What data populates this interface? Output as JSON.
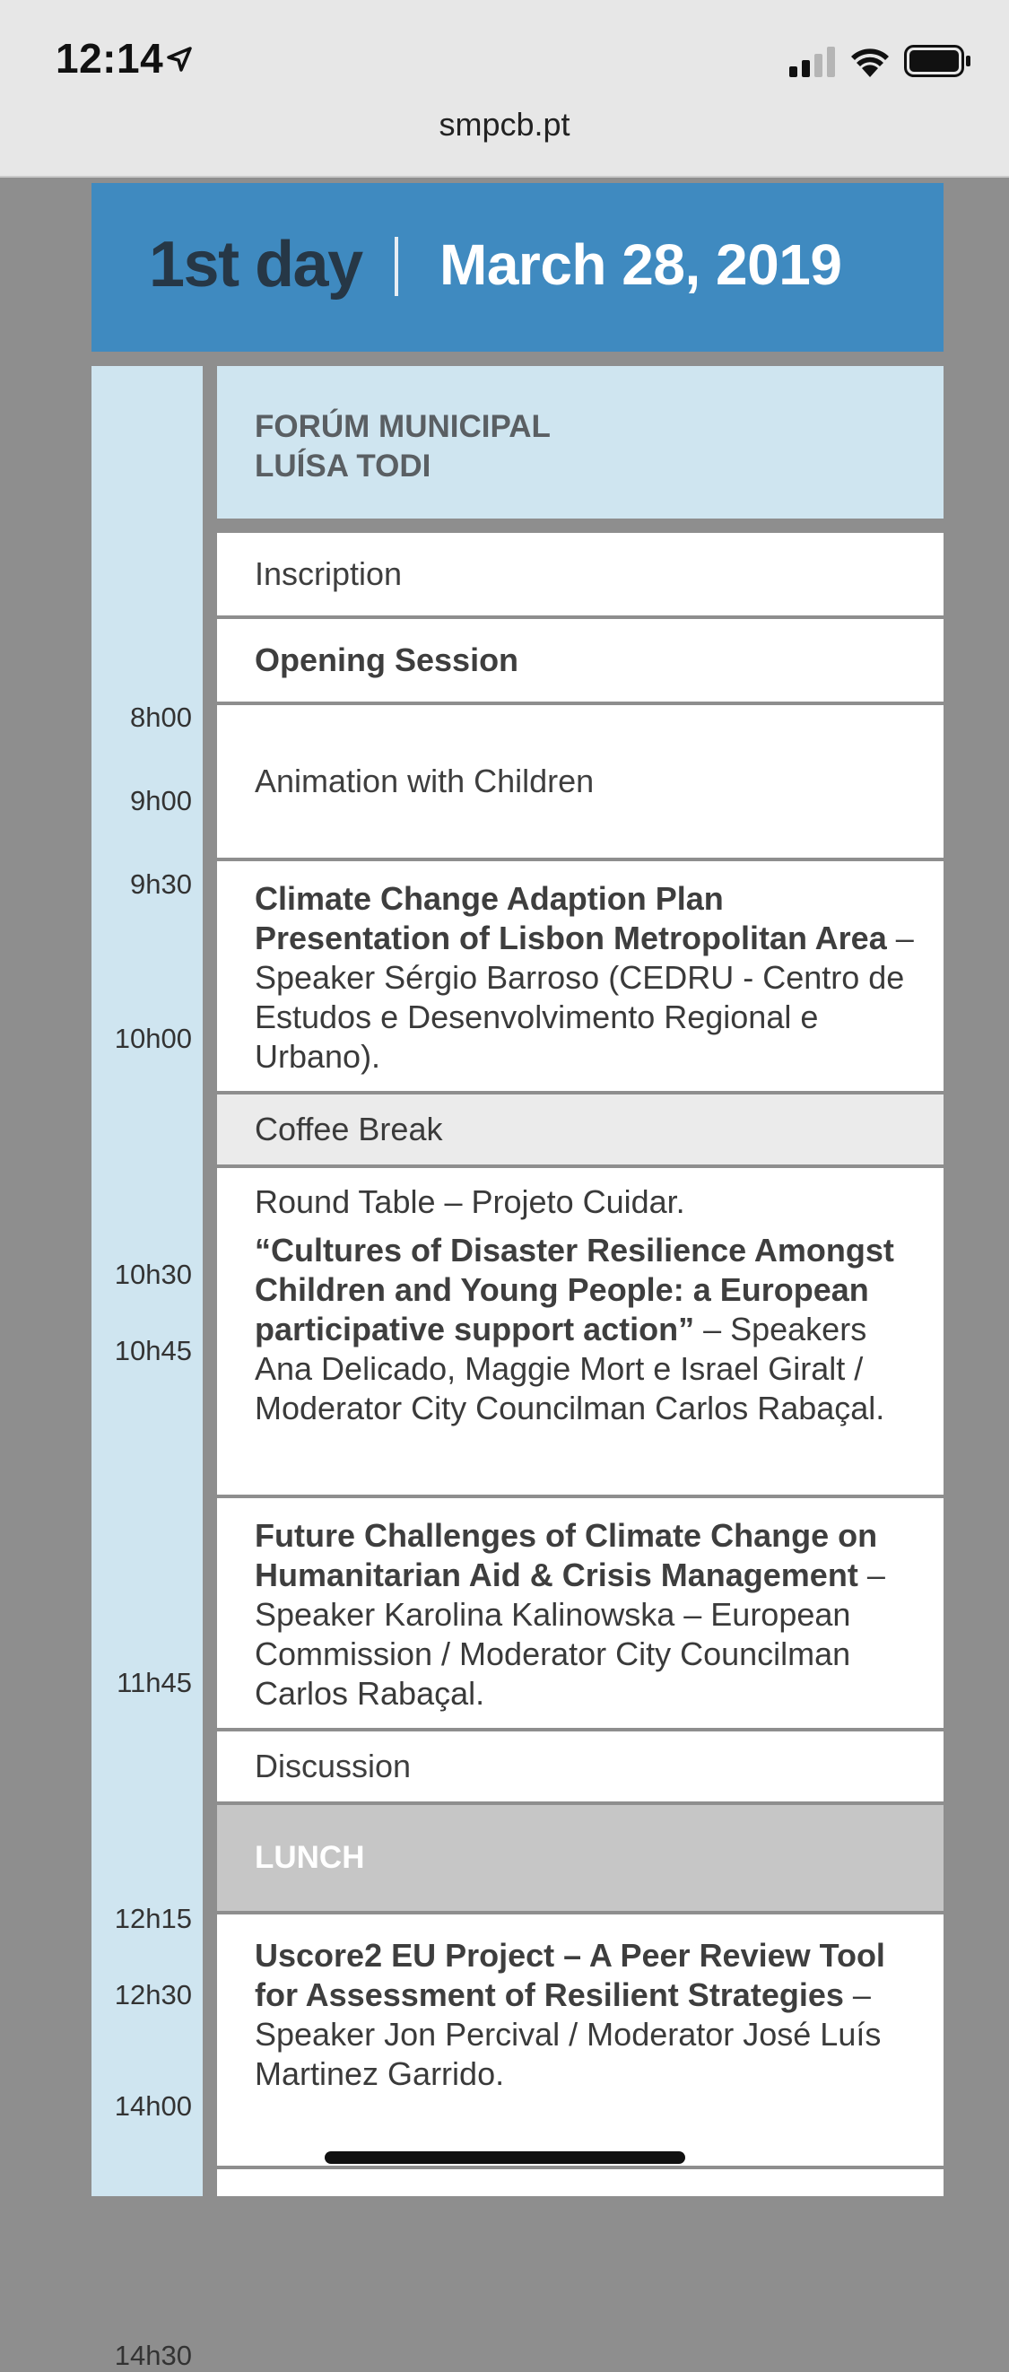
{
  "status_bar": {
    "time": "12:14"
  },
  "browser": {
    "url": "smpcb.pt"
  },
  "day_header": {
    "day": "1st day",
    "date": "March 28, 2019"
  },
  "venue": {
    "line1": "FORÚM MUNICIPAL",
    "line2": "LUÍSA TODI"
  },
  "times": [
    "8h00",
    "9h00",
    "9h30",
    "10h00",
    "10h30",
    "10h45",
    "11h45",
    "12h15",
    "12h30",
    "14h00",
    "14h30"
  ],
  "sessions": {
    "inscription": "Inscription",
    "opening": "Opening Session",
    "animation": "Animation with Children",
    "climate_bold": "Climate Change Adaption Plan Presentation of Lisbon Metropolitan Area",
    "climate_rest": " – Speaker Sérgio Barroso (CEDRU - Centro de Estudos e Desenvolvimento Regional e Urbano).",
    "coffee": "Coffee Break",
    "round_table_intro": "Round Table – Projeto Cuidar.",
    "round_table_bold": "“Cultures of Disaster Resilience Amongst Children and Young People: a European participative support action”",
    "round_table_rest": " – Speakers Ana Delicado, Maggie Mort e Israel Giralt / Moderator City Councilman Carlos Rabaçal.",
    "future_bold": "Future Challenges of Climate Change on Humanitarian Aid & Crisis Management",
    "future_rest": " – Speaker Karolina Kalinowska – European Commission / Moderator City Councilman Carlos Rabaçal.",
    "discussion": "Discussion",
    "lunch": "LUNCH",
    "uscore_bold": "Uscore2 EU Project – A Peer Review Tool for Assessment of Resilient Strategies",
    "uscore_rest": " – Speaker Jon Percival / Moderator José Luís Martinez Garrido."
  }
}
